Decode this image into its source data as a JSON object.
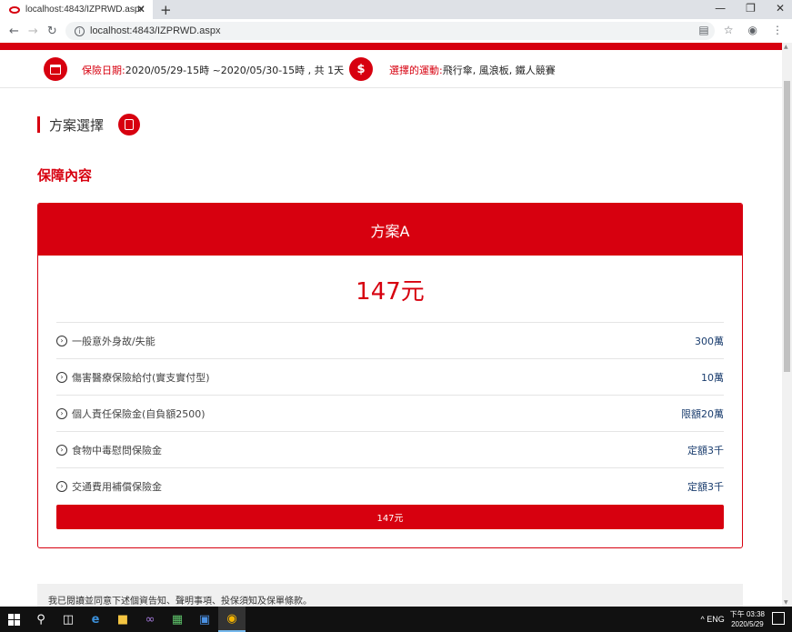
{
  "browser": {
    "tab_title": "localhost:4843/IZPRWD.aspx",
    "tab_close": "✕",
    "new_tab": "+",
    "url": "localhost:4843/IZPRWD.aspx",
    "info_glyph": "i"
  },
  "header": {
    "date_label": "保險日期:",
    "date_value": "2020/05/29-15時 ~2020/05/30-15時 , 共 1天",
    "dollar_glyph": "$",
    "sport_label": "選擇的運動:",
    "sport_value": "飛行傘, 風浪板, 鐵人競賽"
  },
  "section": {
    "title": "方案選擇",
    "coverage_title": "保障內容"
  },
  "plan": {
    "name": "方案A",
    "price": "147元",
    "button_label": "147元",
    "rows": [
      {
        "label": "一般意外身故/失能",
        "value": "300萬"
      },
      {
        "label": "傷害醫療保險給付(實支實付型)",
        "value": "10萬"
      },
      {
        "label": "個人責任保險金(自負額2500)",
        "value": "限額20萬"
      },
      {
        "label": "食物中毒慰問保險金",
        "value": "定額3千"
      },
      {
        "label": "交通費用補償保險金",
        "value": "定額3千"
      }
    ]
  },
  "notice": {
    "text": "我已閱讀並同意下述個資告知、聲明事項、投保須知及保單條款。"
  },
  "taskbar": {
    "tray_text": "^  ENG",
    "clock_line1": "下午 03:38",
    "clock_line2": "2020/5/29"
  },
  "colors": {
    "brand_red": "#d7000f",
    "value_blue": "#1a3d6e"
  }
}
